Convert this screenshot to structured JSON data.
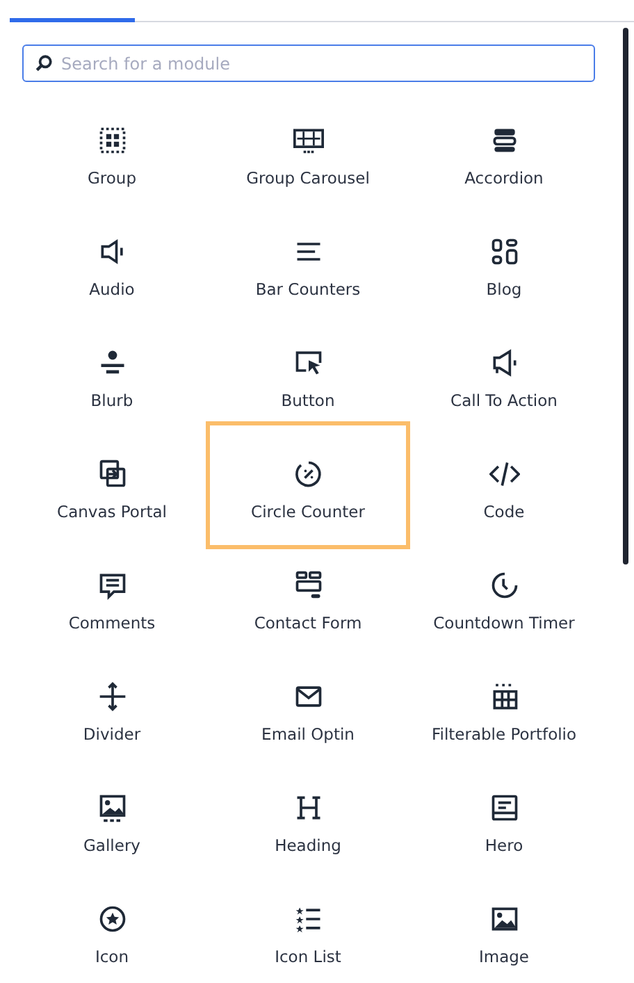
{
  "tabs": [
    {
      "selected": true
    }
  ],
  "search": {
    "placeholder": "Search for a module"
  },
  "modules": [
    {
      "label": "Group",
      "kind": "group",
      "selected": false
    },
    {
      "label": "Group Carousel",
      "kind": "carousel",
      "selected": false
    },
    {
      "label": "Accordion",
      "kind": "accordion",
      "selected": false
    },
    {
      "label": "Audio",
      "kind": "speaker",
      "selected": false
    },
    {
      "label": "Bar Counters",
      "kind": "lines",
      "selected": false
    },
    {
      "label": "Blog",
      "kind": "blog",
      "selected": false
    },
    {
      "label": "Blurb",
      "kind": "blurb",
      "selected": false
    },
    {
      "label": "Button",
      "kind": "pointer",
      "selected": false
    },
    {
      "label": "Call To Action",
      "kind": "megaphone",
      "selected": false
    },
    {
      "label": "Canvas Portal",
      "kind": "portal",
      "selected": false
    },
    {
      "label": "Circle Counter",
      "kind": "percent",
      "selected": true
    },
    {
      "label": "Code",
      "kind": "code",
      "selected": false
    },
    {
      "label": "Comments",
      "kind": "comment",
      "selected": false
    },
    {
      "label": "Contact Form",
      "kind": "form",
      "selected": false
    },
    {
      "label": "Countdown Timer",
      "kind": "clock",
      "selected": false
    },
    {
      "label": "Divider",
      "kind": "divider",
      "selected": false
    },
    {
      "label": "Email Optin",
      "kind": "envelope",
      "selected": false
    },
    {
      "label": "Filterable Portfolio",
      "kind": "grid",
      "selected": false
    },
    {
      "label": "Gallery",
      "kind": "gallery",
      "selected": false
    },
    {
      "label": "Heading",
      "kind": "heading",
      "selected": false
    },
    {
      "label": "Hero",
      "kind": "hero",
      "selected": false
    },
    {
      "label": "Icon",
      "kind": "star",
      "selected": false
    },
    {
      "label": "Icon List",
      "kind": "starlist",
      "selected": false
    },
    {
      "label": "Image",
      "kind": "image",
      "selected": false
    }
  ]
}
